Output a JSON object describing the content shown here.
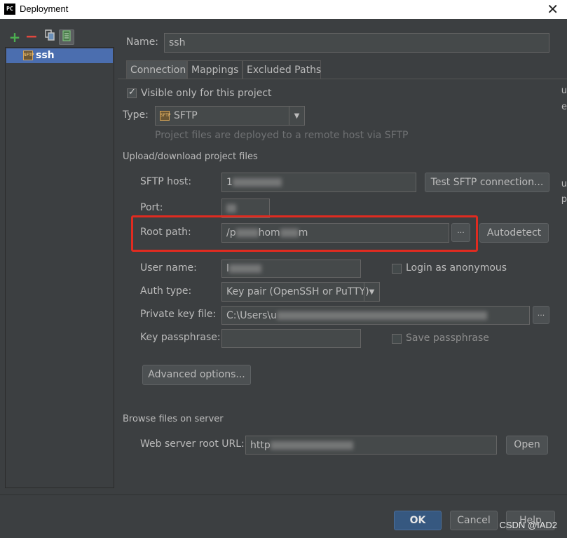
{
  "window": {
    "title": "Deployment",
    "app_icon": "PC",
    "close_glyph": "✕"
  },
  "toolbar": {
    "add": "+",
    "remove": "−"
  },
  "sidebar": {
    "items": [
      {
        "label": "ssh",
        "icon": "sftp-server-icon"
      }
    ]
  },
  "server": {
    "name_label": "Name:",
    "name_value": "ssh"
  },
  "tabs": [
    {
      "label": "Connection",
      "active": true
    },
    {
      "label": "Mappings"
    },
    {
      "label": "Excluded Paths"
    }
  ],
  "connection": {
    "visible_only_label": "Visible only for this project",
    "visible_only_checked": true,
    "type_label": "Type:",
    "type_value": "SFTP",
    "type_hint": "Project files are deployed to a remote host via SFTP",
    "upload_section": "Upload/download project files",
    "sftp_host_label": "SFTP host:",
    "sftp_host_value": "1",
    "test_button": "Test SFTP connection...",
    "port_label": "Port:",
    "port_value": "",
    "root_path_label": "Root path:",
    "root_path_value_start": "/p",
    "root_path_value_mid": "hom",
    "root_path_value_end": "m",
    "root_browse": "...",
    "autodetect_button": "Autodetect",
    "user_name_label": "User name:",
    "user_name_value": "l",
    "anonymous_label": "Login as anonymous",
    "auth_type_label": "Auth type:",
    "auth_type_value": "Key pair (OpenSSH or PuTTY)",
    "private_key_label": "Private key file:",
    "private_key_value": "C:\\Users\\u",
    "private_key_browse": "...",
    "passphrase_label": "Key passphrase:",
    "passphrase_value": "",
    "save_passphrase_label": "Save passphrase",
    "advanced_button": "Advanced options...",
    "browse_section": "Browse files on server",
    "web_root_label": "Web server root URL:",
    "web_root_value": "http",
    "open_button": "Open"
  },
  "footer": {
    "ok": "OK",
    "cancel": "Cancel",
    "help": "Help"
  },
  "watermark": "CSDN @IAD2",
  "edge_fragments": [
    "u",
    "e",
    "u",
    "p"
  ]
}
